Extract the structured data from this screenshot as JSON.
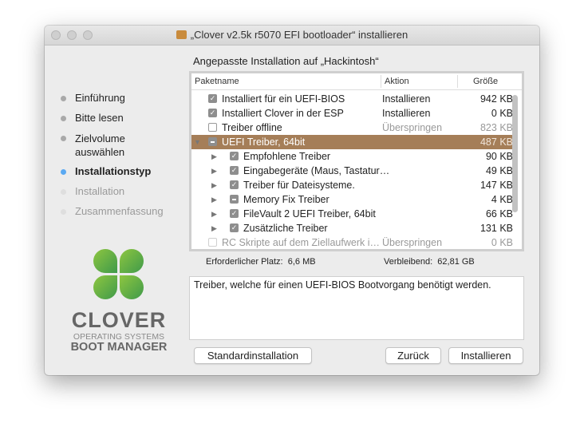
{
  "window": {
    "title": "„Clover v2.5k r5070 EFI bootloader“ installieren"
  },
  "steps": [
    "Einführung",
    "Bitte lesen",
    "Zielvolume auswählen",
    "Installationstyp",
    "Installation",
    "Zusammenfassung"
  ],
  "logo": {
    "word": "CLOVER",
    "line1": "OPERATING SYSTEMS",
    "line2": "BOOT MANAGER"
  },
  "heading": "Angepasste Installation auf „Hackintosh“",
  "table": {
    "headers": {
      "name": "Paketname",
      "action": "Aktion",
      "size": "Größe"
    },
    "rows": [
      {
        "name": "Installiert für ein UEFI-BIOS",
        "action": "Installieren",
        "size": "942 KB"
      },
      {
        "name": "Installiert Clover in der ESP",
        "action": "Installieren",
        "size": "0 KB"
      },
      {
        "name": "Treiber offline",
        "action": "Überspringen",
        "size": "823 KB"
      },
      {
        "name": "UEFI Treiber, 64bit",
        "action": "",
        "size": "487 KB"
      },
      {
        "name": "Empfohlene Treiber",
        "action": "",
        "size": "90 KB"
      },
      {
        "name": "Eingabegeräte (Maus, Tastatur…",
        "action": "",
        "size": "49 KB"
      },
      {
        "name": "Treiber für Dateisysteme.",
        "action": "",
        "size": "147 KB"
      },
      {
        "name": "Memory Fix Treiber",
        "action": "",
        "size": "4 KB"
      },
      {
        "name": "FileVault 2 UEFI Treiber, 64bit",
        "action": "",
        "size": "66 KB"
      },
      {
        "name": "Zusätzliche Treiber",
        "action": "",
        "size": "131 KB"
      },
      {
        "name": "RC Skripte auf dem Ziellaufwerk i…",
        "action": "Überspringen",
        "size": "0 KB"
      }
    ]
  },
  "status": {
    "required_label": "Erforderlicher Platz:",
    "required": "6,6 MB",
    "remaining_label": "Verbleibend:",
    "remaining": "62,81 GB"
  },
  "description": "Treiber, welche für einen UEFI-BIOS Bootvorgang benötigt werden.",
  "buttons": {
    "standard": "Standardinstallation",
    "back": "Zurück",
    "install": "Installieren"
  }
}
